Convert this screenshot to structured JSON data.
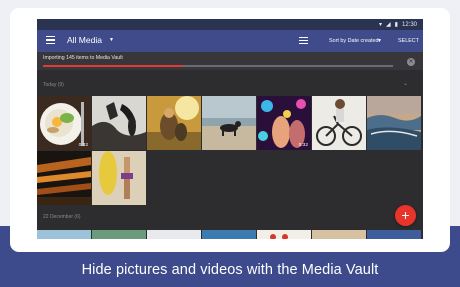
{
  "app": {
    "status_time": "12:30",
    "title": "All Media",
    "sort_label": "Sort by Date created",
    "select_label": "SELECT"
  },
  "import": {
    "text": "Importing 145 items to Media Vault",
    "progress": 0.4
  },
  "sections": [
    {
      "label": "Today (9)"
    },
    {
      "label": "22 December (6)"
    }
  ],
  "thumbnails": [
    {
      "name": "food-plate",
      "duration": "0:32"
    },
    {
      "name": "surfer-rocks"
    },
    {
      "name": "sunset-couple"
    },
    {
      "name": "beach-dog"
    },
    {
      "name": "party-lights",
      "duration": "0:32"
    },
    {
      "name": "bicycle-girl"
    },
    {
      "name": "ocean-waves"
    },
    {
      "name": "bridge-night"
    },
    {
      "name": "surfboard-beach"
    }
  ],
  "caption": "Hide pictures and videos with the Media Vault",
  "colors": {
    "toolbar": "#3f4b8b",
    "background_band": "#3d4a8c",
    "progress": "#e03a32",
    "fab": "#e8342b"
  }
}
